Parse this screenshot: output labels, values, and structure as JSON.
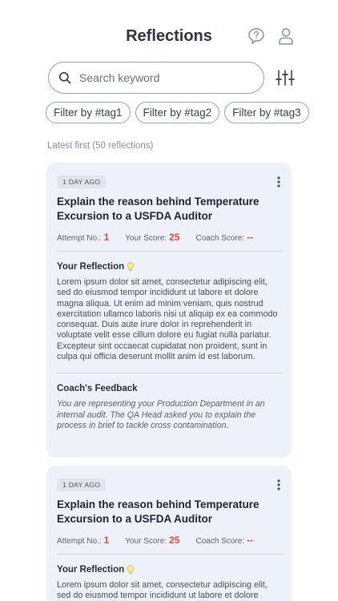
{
  "header": {
    "title": "Reflections",
    "icons": {
      "help": "help-question-icon",
      "profile": "user-profile-icon"
    }
  },
  "search": {
    "placeholder": "Search keyword",
    "value": "",
    "icon": "search-icon",
    "filter_icon": "sliders-filter-icon"
  },
  "filters": [
    {
      "label": "Filter by #tag1"
    },
    {
      "label": "Filter by #tag2"
    },
    {
      "label": "Filter by #tag3"
    }
  ],
  "list": {
    "sort_label": "Latest first (50 reflections)"
  },
  "labels": {
    "attempt": "Attempt No.:",
    "your_score": "Your Score:",
    "coach_score": "Coach Score:",
    "your_reflection": "Your Reflection",
    "coach_feedback": "Coach's Feedback"
  },
  "cards": [
    {
      "badge": "1 DAY AGO",
      "title": "Explain the reason behind Temperature Excursion to a USFDA Auditor",
      "attempt_no": "1",
      "your_score": "25",
      "coach_score": "--",
      "reflection": "Lorem ipsum dolor sit amet, consectetur adipiscing elit, sed do eiusmod tempor incididunt ut labore et dolore magna aliqua. Ut enim ad minim veniam, quis nostrud exercitation ullamco laboris nisi ut aliquip ex ea commodo consequat. Duis aute irure dolor in reprehenderit in voluptate velit esse cillum dolore eu fugiat nulla pariatur. Excepteur sint occaecat cupidatat non proident, sunt in culpa qui officia deserunt mollit anim id est laborum.",
      "feedback": "You are representing your Production Department in an internal audit. The QA Head asked you to explain the process in brief to tackle cross contamination."
    },
    {
      "badge": "1 DAY AGO",
      "title": "Explain the reason behind Temperature Excursion to a USFDA Auditor",
      "attempt_no": "1",
      "your_score": "25",
      "coach_score": "--",
      "reflection": "Lorem ipsum dolor sit amet, consectetur adipiscing elit, sed do eiusmod tempor incididunt ut labore et dolore"
    }
  ],
  "colors": {
    "accent_score": "#e2463f",
    "card_bg": "#eff1f9",
    "bulb": "#f2c94c"
  }
}
